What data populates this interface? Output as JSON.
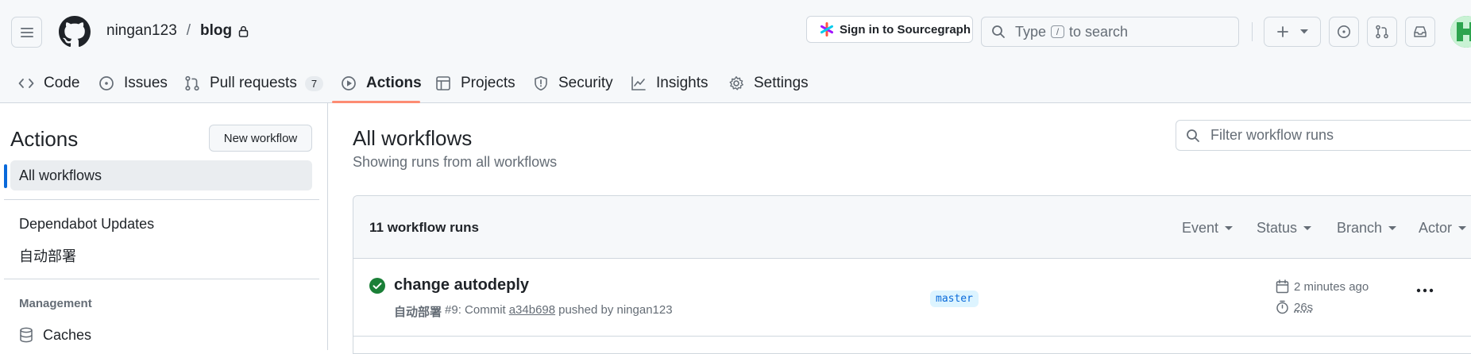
{
  "header": {
    "owner": "ningan123",
    "separator": "/",
    "repo": "blog",
    "sourcegraph_label": "Sign in to Sourcegraph",
    "search": {
      "prefix": "Type",
      "key": "/",
      "suffix": "to search"
    }
  },
  "tabs": [
    {
      "label": "Code",
      "icon": "code-icon"
    },
    {
      "label": "Issues",
      "icon": "issue-icon"
    },
    {
      "label": "Pull requests",
      "icon": "pull-request-icon",
      "count": "7"
    },
    {
      "label": "Actions",
      "icon": "play-icon",
      "active": true
    },
    {
      "label": "Projects",
      "icon": "table-icon"
    },
    {
      "label": "Security",
      "icon": "shield-icon"
    },
    {
      "label": "Insights",
      "icon": "graph-icon"
    },
    {
      "label": "Settings",
      "icon": "gear-icon"
    }
  ],
  "sidebar": {
    "title": "Actions",
    "new_workflow_label": "New workflow",
    "items": [
      {
        "label": "All workflows",
        "active": true
      },
      {
        "label": "Dependabot Updates"
      },
      {
        "label": "自动部署"
      }
    ],
    "management_heading": "Management",
    "management_items": [
      {
        "label": "Caches",
        "icon": "database-icon"
      }
    ]
  },
  "main": {
    "title": "All workflows",
    "subtitle": "Showing runs from all workflows",
    "filter_placeholder": "Filter workflow runs",
    "runs_count": "11 workflow runs",
    "filters": [
      "Event",
      "Status",
      "Branch",
      "Actor"
    ],
    "runs": [
      {
        "title": "change autodeply",
        "workflow": "自动部署",
        "run_number": "#9: Commit",
        "sha": "a34b698",
        "pushed_by": "pushed by ningan123",
        "branch": "master",
        "when": "2 minutes ago",
        "duration": "26s",
        "status": "success"
      }
    ]
  },
  "colors": {
    "accent": "#0969da",
    "success": "#1a7f37",
    "tab_underline": "#fd8c73",
    "header_bg": "#f6f8fa",
    "border": "#d0d7de"
  }
}
